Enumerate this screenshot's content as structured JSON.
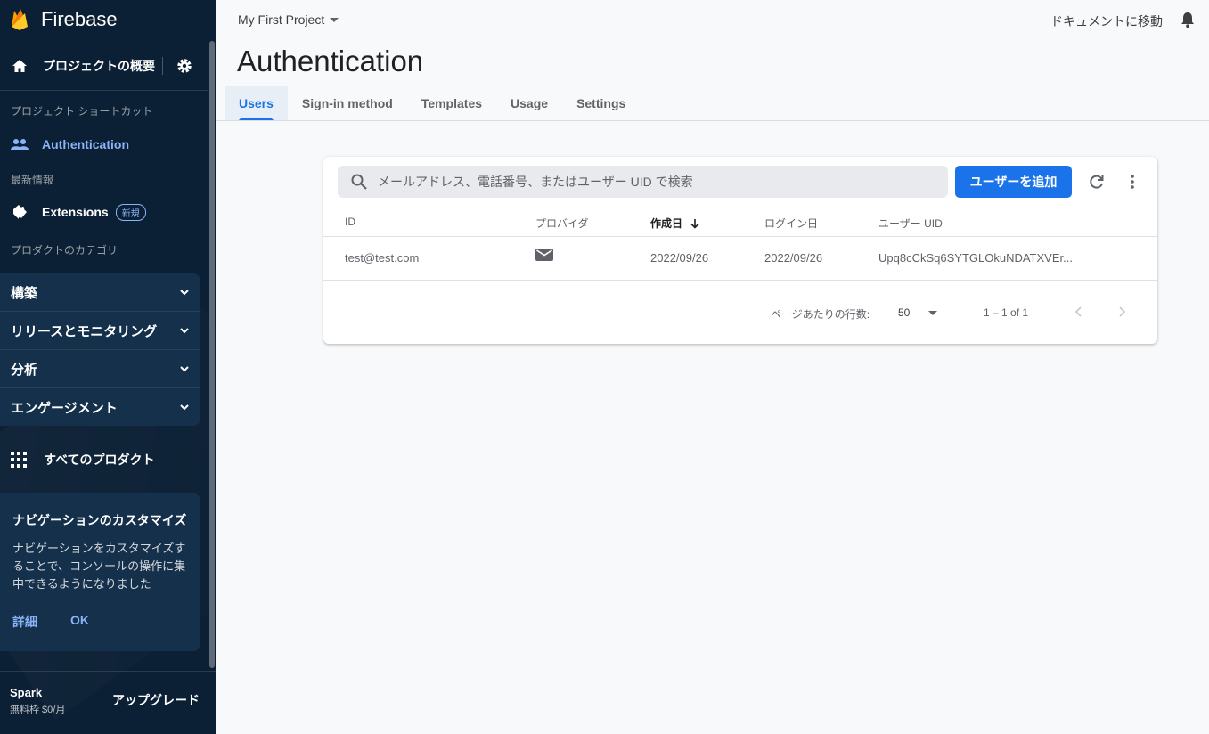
{
  "sidebar": {
    "brand": "Firebase",
    "overview_label": "プロジェクトの概要",
    "shortcuts_label": "プロジェクト ショートカット",
    "shortcut_item": "Authentication",
    "latest_label": "最新情報",
    "extensions_label": "Extensions",
    "extensions_badge": "新規",
    "categories_label": "プロダクトのカテゴリ",
    "categories": [
      "構築",
      "リリースとモニタリング",
      "分析",
      "エンゲージメント"
    ],
    "all_products": "すべてのプロダクト",
    "customize": {
      "title": "ナビゲーションのカスタマイズ",
      "body": "ナビゲーションをカスタマイズすることで、コンソールの操作に集中できるようになりました",
      "details": "詳細",
      "ok": "OK"
    },
    "plan": {
      "name": "Spark",
      "detail": "無料枠 $0/月",
      "upgrade": "アップグレード"
    }
  },
  "header": {
    "project": "My First Project",
    "docs": "ドキュメントに移動",
    "title": "Authentication"
  },
  "tabs": [
    "Users",
    "Sign-in method",
    "Templates",
    "Usage",
    "Settings"
  ],
  "users": {
    "search_placeholder": "メールアドレス、電話番号、またはユーザー UID で検索",
    "add_button": "ユーザーを追加",
    "columns": {
      "id": "ID",
      "provider": "プロバイダ",
      "created": "作成日",
      "signed_in": "ログイン日",
      "uid": "ユーザー UID"
    },
    "rows": [
      {
        "id": "test@test.com",
        "provider": "email",
        "created": "2022/09/26",
        "signed_in": "2022/09/26",
        "uid": "Upq8cCkSq6SYTGLOkuNDATXVEr..."
      }
    ],
    "pager": {
      "rows_label": "ページあたりの行数:",
      "rows_value": "50",
      "range": "1 – 1 of 1"
    }
  },
  "colors": {
    "accent": "#1a73e8",
    "sidebar_bg": "#0c2035",
    "sidebar_link": "#8ab4f8"
  }
}
